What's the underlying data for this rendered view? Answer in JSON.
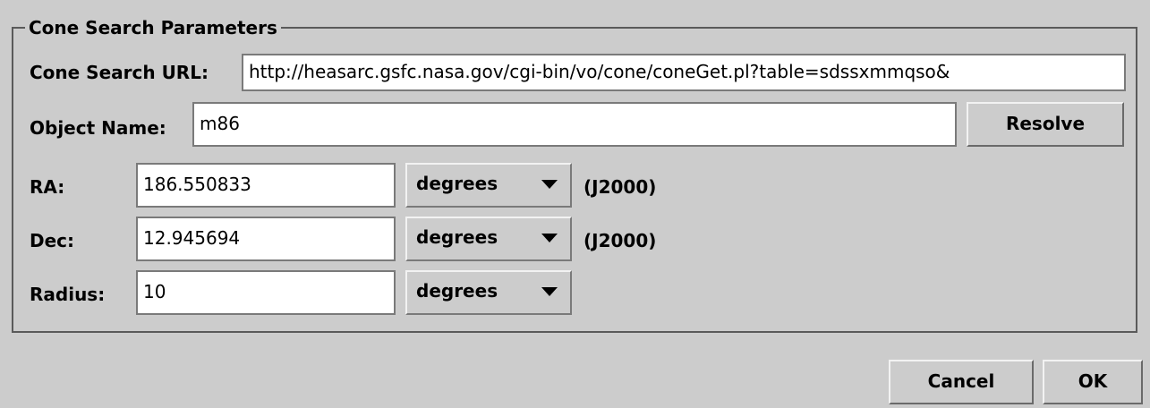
{
  "panel": {
    "title": "Cone Search Parameters"
  },
  "url_row": {
    "label": "Cone Search URL:",
    "value": "http://heasarc.gsfc.nasa.gov/cgi-bin/vo/cone/coneGet.pl?table=sdssxmmqso&"
  },
  "object_row": {
    "label": "Object Name:",
    "value": "m86",
    "resolve_label": "Resolve"
  },
  "ra_row": {
    "label": "RA:",
    "value": "186.550833",
    "units": "degrees",
    "epoch": "(J2000)"
  },
  "dec_row": {
    "label": "Dec:",
    "value": "12.945694",
    "units": "degrees",
    "epoch": "(J2000)"
  },
  "radius_row": {
    "label": "Radius:",
    "value": "10",
    "units": "degrees"
  },
  "buttons": {
    "cancel_label": "Cancel",
    "ok_label": "OK"
  },
  "icons": {
    "dropdown": "chevron-down-icon"
  }
}
